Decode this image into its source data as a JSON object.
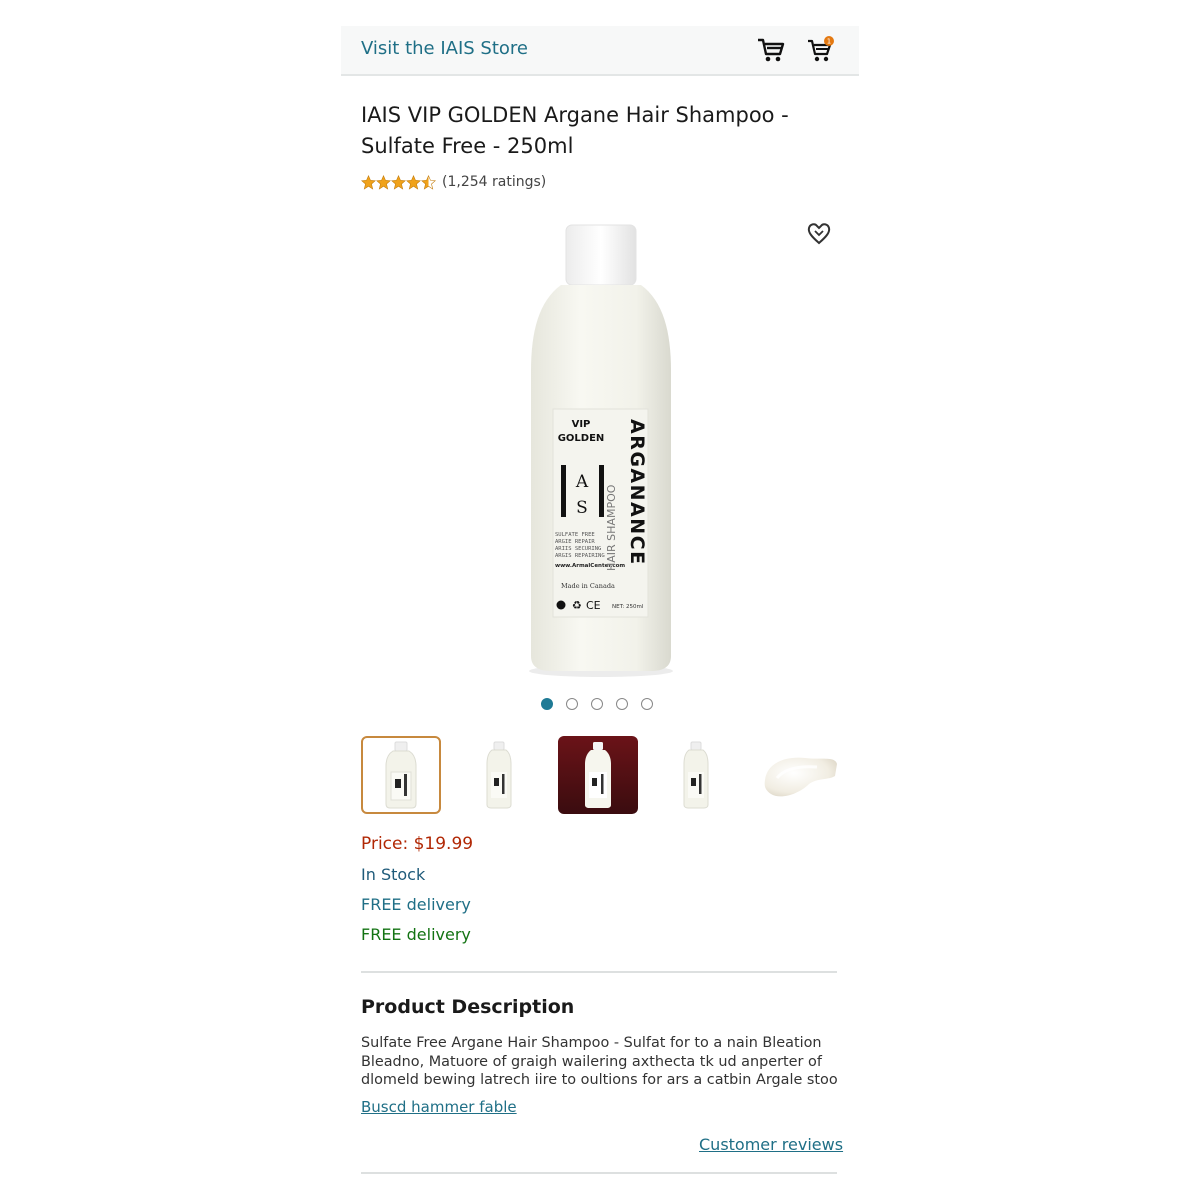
{
  "header": {
    "store_link": "Visit the IAIS Store",
    "cart_icon": "cart-icon",
    "cart_badge_icon": "cart-badge-icon"
  },
  "product": {
    "title": "IAIS VIP GOLDEN Argane Hair Shampoo - Sulfate Free - 250ml",
    "rating_value": 4.5,
    "rating_max": 5,
    "ratings_count": "(1,254 ratings)",
    "star_color": "#f0a21a"
  },
  "gallery": {
    "wishlist_icon": "heart-icon",
    "label": {
      "line1": "VIP",
      "line2": "GOLDEN",
      "brand_top": "A",
      "brand_bottom": "S",
      "brand_side": "I",
      "vertical_word": "ARGANANCE",
      "vertical_sub": "HAIR SHAMPOO",
      "small_text_1": "SULFATE FREE",
      "small_text_2": "ARGIE REPAIR",
      "small_text_3": "ARIIS SECURING",
      "small_text_4": "ARGIS REPAIRING",
      "website": "www.ArmalCenter.com",
      "made_in": "Made in Canada",
      "net": "NET: 250ml"
    },
    "dots": {
      "count": 5,
      "active_index": 0
    },
    "thumbnails": [
      "bottle-front",
      "bottle-small",
      "bottle-red-background",
      "bottle-small-2",
      "cream-swatch"
    ],
    "selected_thumbnail": 0
  },
  "buy_box": {
    "price": "Price: $19.99",
    "stock": "In Stock",
    "delivery_1": "FREE delivery",
    "delivery_2": "FREE delivery"
  },
  "description": {
    "heading": "Product Description",
    "lines": [
      "Sulfate Free Argane Hair Shampoo - Sulfat for to a nain Bleation",
      "Bleadno, Matuore of graigh wailering axthecta tk ud anperter of",
      "dlomeld bewing latrech iire to oultions for ars a catbin Argale stood"
    ],
    "link": "Buscd hammer fable",
    "reviews_link": "Customer reviews"
  },
  "colors": {
    "link": "#1f6f86",
    "price": "#b12704",
    "stock": "#1f5b7a",
    "delivery_green": "#137313",
    "thumb_selected_border": "#c7893e",
    "dot_active": "#1f7a95"
  }
}
